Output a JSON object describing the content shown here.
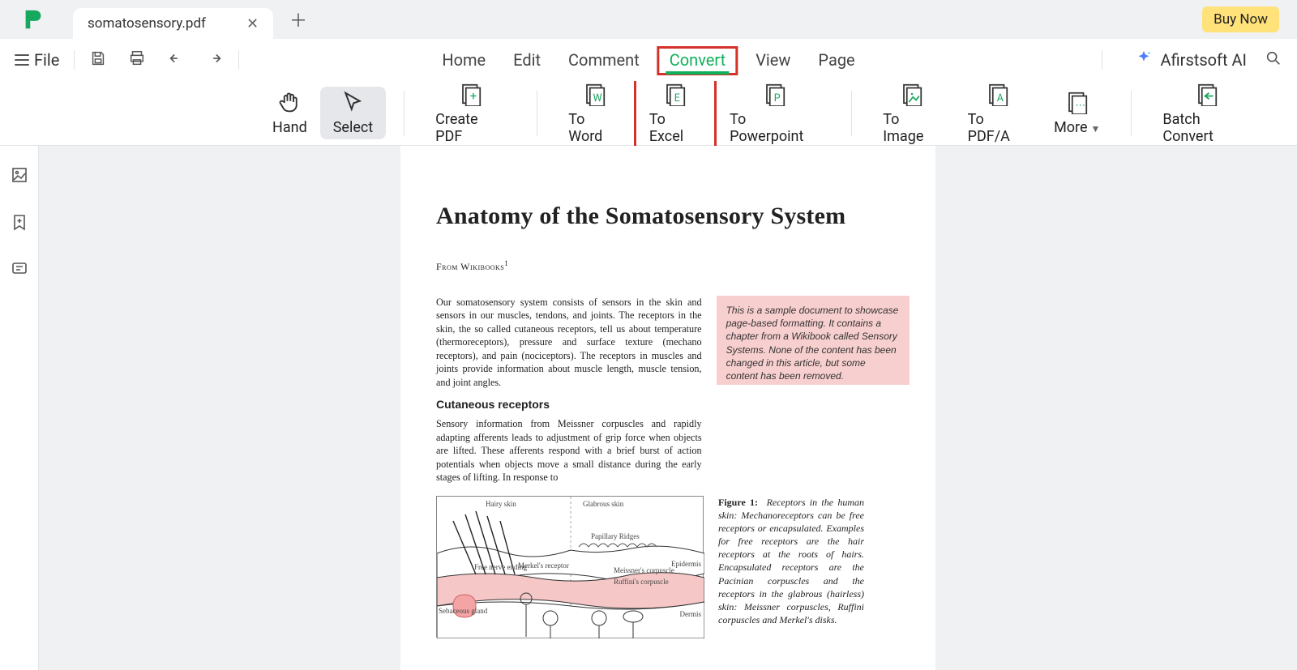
{
  "app": {
    "tab_title": "somatosensory.pdf",
    "buy_now": "Buy Now",
    "file_label": "File",
    "ai_label": "Afirstsoft AI"
  },
  "menu": {
    "items": [
      "Home",
      "Edit",
      "Comment",
      "Convert",
      "View",
      "Page"
    ]
  },
  "ribbon": {
    "hand": "Hand",
    "select": "Select",
    "create_pdf": "Create PDF",
    "to_word": "To Word",
    "to_excel": "To Excel",
    "to_powerpoint": "To Powerpoint",
    "to_image": "To Image",
    "to_pdfa": "To PDF/A",
    "more": "More",
    "batch_convert": "Batch Convert"
  },
  "doc": {
    "title": "Anatomy of the Somatosensory System",
    "byline_part1": "From Wikibooks",
    "byline_sup": "1",
    "para1": "Our somatosensory system consists of sensors in the skin and sensors in our muscles, tendons, and joints. The receptors in the skin, the so called cutaneous receptors, tell us about temperature (thermoreceptors), pressure and surface texture (mechano receptors), and pain (nociceptors). The receptors in muscles and joints provide information about muscle length, muscle tension, and joint angles.",
    "subhead": "Cutaneous receptors",
    "para2": "Sensory information from Meissner corpuscles and rapidly adapting afferents leads to adjustment of grip force when objects are lifted. These afferents respond with a brief burst of action potentials when objects move a small distance during the early stages of lifting. In response to",
    "notebox": "This is a sample document to showcase page-based formatting. It contains a chapter from a Wikibook called Sensory Systems. None of the content has been changed in this article, but some content has been removed.",
    "fig_lead": "Figure 1:",
    "fig_caption": "Receptors in the human skin: Mechanoreceptors can be free receptors or encapsulated. Examples for free receptors are the hair receptors at the roots of hairs. Encapsulated receptors are the Pacinian corpuscles and the receptors in the glabrous (hairless) skin: Meissner corpuscles, Ruffini corpuscles and Merkel's disks.",
    "labels": {
      "hairy": "Hairy skin",
      "glabrous": "Glabrous skin",
      "epidermis": "Epidermis",
      "dermis": "Dermis",
      "papillary": "Papillary Ridges",
      "free_nerve": "Free nerve ending",
      "sebaceous": "Sebaceous gland",
      "merkels": "Merkel's receptor",
      "meissner": "Meissner's corpuscle",
      "ruffini": "Ruffini's corpuscle"
    }
  }
}
